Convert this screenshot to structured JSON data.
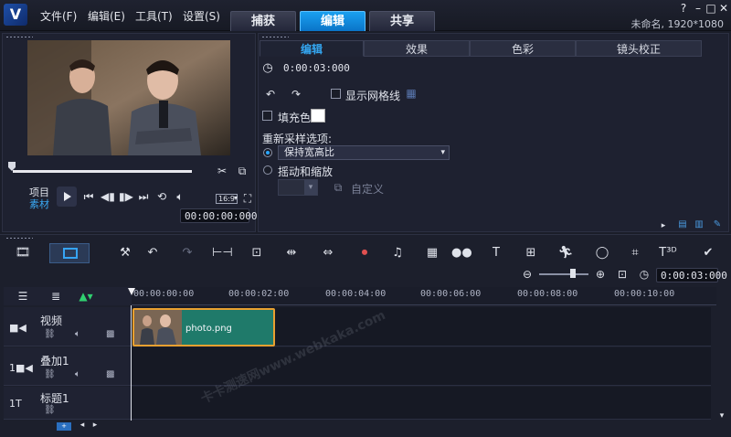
{
  "app": {
    "logo_letter": "V",
    "menu": [
      "文件(F)",
      "编辑(E)",
      "工具(T)",
      "设置(S)"
    ],
    "tabs": [
      "捕获",
      "编辑",
      "共享"
    ],
    "active_tab": "编辑",
    "project_title": "未命名, 1920*1080"
  },
  "player": {
    "mode_project": "项目",
    "mode_clip": "素材",
    "aspect": "16:9",
    "timecode": "00:00:00:000"
  },
  "edit_panel": {
    "tabs": [
      "编辑",
      "效果",
      "色彩",
      "镜头校正"
    ],
    "duration": "0:00:03:000",
    "show_grid_label": "显示网格线",
    "fill_color_label": "填充色",
    "resample_label": "重新采样选项:",
    "keep_aspect_option": "保持宽高比",
    "pan_zoom_label": "摇动和缩放",
    "custom_label": "自定义"
  },
  "timeline": {
    "zoom_timecode": "0:00:03:000",
    "ruler": [
      "00:00:00:00",
      "00:00:02:00",
      "00:00:04:00",
      "00:00:06:00",
      "00:00:08:00",
      "00:00:10:00"
    ],
    "tracks": [
      {
        "name": "视频"
      },
      {
        "name": "叠加1"
      },
      {
        "name": "标题1"
      }
    ],
    "clip_name": "photo.png",
    "watermark": "卡卡测速网www.webkaka.com"
  }
}
